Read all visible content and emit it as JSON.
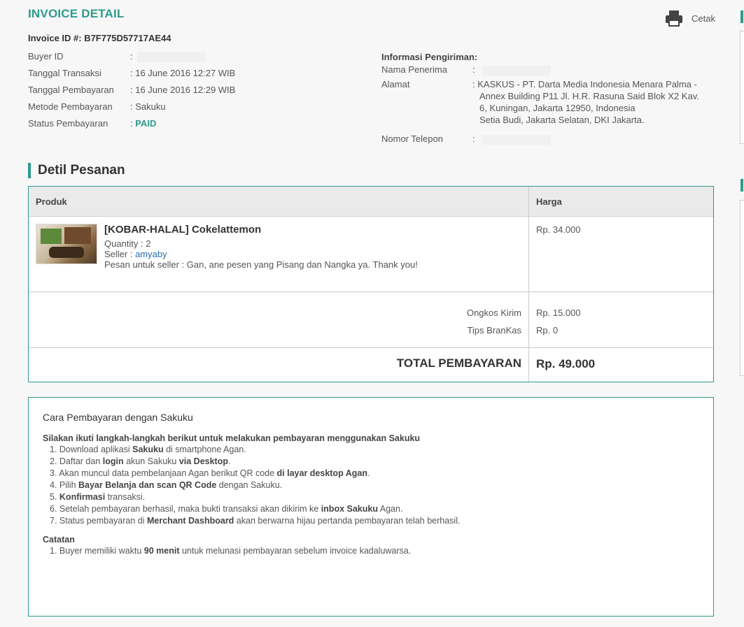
{
  "header": {
    "title": "INVOICE DETAIL",
    "print_label": "Cetak"
  },
  "invoice": {
    "id_label": "Invoice ID #: B7F775D57717AE44",
    "fields": [
      {
        "label": "Buyer ID",
        "value": ""
      },
      {
        "label": "Tanggal Transaksi",
        "value": "16 June 2016 12:27 WIB"
      },
      {
        "label": "Tanggal Pembayaran",
        "value": "16 June 2016 12:29 WIB"
      },
      {
        "label": "Metode Pembayaran",
        "value": "Sakuku"
      },
      {
        "label": "Status Pembayaran",
        "value": "PAID"
      }
    ]
  },
  "shipping": {
    "heading": "Informasi Pengiriman:",
    "recipient_label": "Nama Penerima",
    "address_label": "Alamat",
    "address_line1": "KASKUS - PT. Darta Media Indonesia Menara Palma -",
    "address_line2": "Annex Building P11 Jl. H.R. Rasuna Said Blok X2 Kav.",
    "address_line3": "6, Kuningan, Jakarta 12950, Indonesia",
    "address_line4": "Setia Budi, Jakarta Selatan, DKI Jakarta.",
    "phone_label": "Nomor Telepon"
  },
  "order": {
    "section_title": "Detil Pesanan",
    "col_product": "Produk",
    "col_price": "Harga",
    "product": {
      "name": "[KOBAR-HALAL] Cokelattemon",
      "quantity": "Quantity : 2",
      "seller_prefix": "Seller : ",
      "seller_name": "amyaby",
      "message": "Pesan untuk seller : Gan, ane pesen yang Pisang dan Nangka ya. Thank you!",
      "price": "Rp. 34.000"
    },
    "shipping_fee_label": "Ongkos Kirim",
    "shipping_fee": "Rp. 15.000",
    "tips_label": "Tips BranKas",
    "tips": "Rp. 0",
    "total_label": "TOTAL PEMBAYARAN",
    "total": "Rp. 49.000"
  },
  "payment": {
    "title": "Cara Pembayaran dengan Sakuku",
    "intro": "Silakan ikuti langkah-langkah berikut untuk melakukan pembayaran menggunakan Sakuku",
    "steps": [
      [
        "1. Download aplikasi ",
        "Sakuku",
        " di smartphone Agan."
      ],
      [
        "2. Daftar dan ",
        "login",
        " akun Sakuku ",
        "via Desktop",
        "."
      ],
      [
        "3. Akan muncul data pembelanjaan Agan berikut QR code ",
        "di layar desktop Agan",
        "."
      ],
      [
        "4. Pilih ",
        "Bayar Belanja dan scan QR Code",
        " dengan Sakuku."
      ],
      [
        "5. ",
        "Konfirmasi",
        " transaksi."
      ],
      [
        "6. Setelah pembayaran berhasil, maka bukti transaksi akan dikirim ke ",
        "inbox Sakuku",
        " Agan."
      ],
      [
        "7. Status pembayaran di ",
        "Merchant Dashboard",
        " akan berwarna hijau pertanda pembayaran telah berhasil."
      ]
    ],
    "note_title": "Catatan",
    "notes": [
      [
        "1. Buyer memiliki waktu ",
        "90 menit",
        " untuk melunasi pembayaran sebelum invoice kadaluwarsa."
      ]
    ]
  },
  "colors": {
    "accent": "#2e9a8c",
    "link": "#2a6fb5"
  }
}
